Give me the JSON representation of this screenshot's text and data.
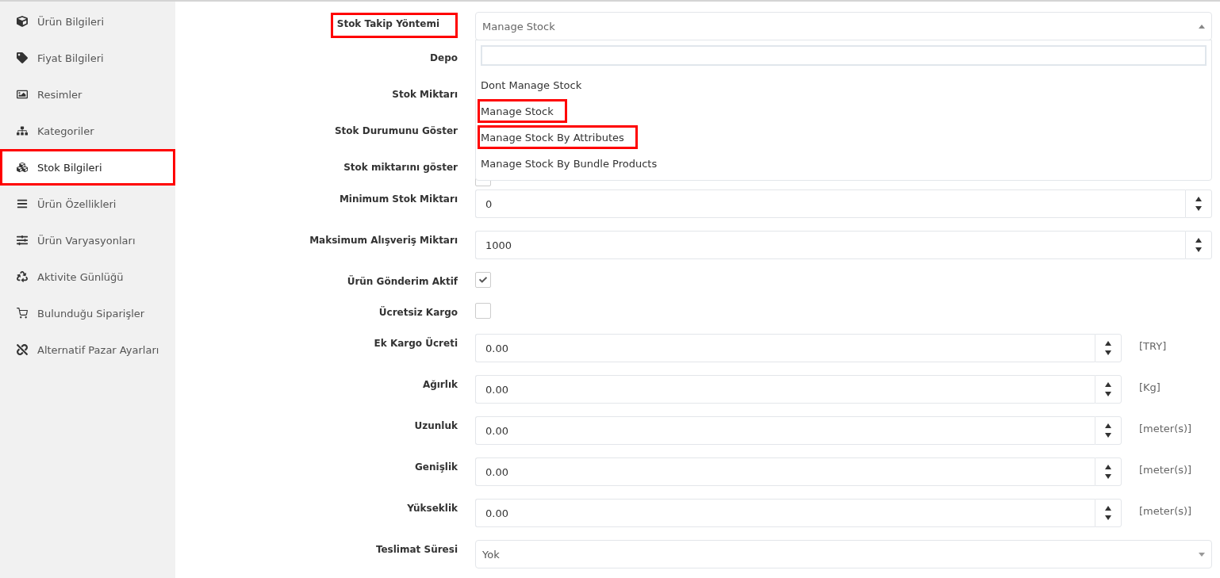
{
  "sidebar": {
    "items": [
      {
        "label": "Ürün Bilgileri",
        "selected": false,
        "highlighted": false
      },
      {
        "label": "Fiyat Bilgileri",
        "selected": false,
        "highlighted": false
      },
      {
        "label": "Resimler",
        "selected": false,
        "highlighted": false
      },
      {
        "label": "Kategoriler",
        "selected": false,
        "highlighted": false
      },
      {
        "label": "Stok Bilgileri",
        "selected": true,
        "highlighted": true
      },
      {
        "label": "Ürün Özellikleri",
        "selected": false,
        "highlighted": false
      },
      {
        "label": "Ürün Varyasyonları",
        "selected": false,
        "highlighted": false
      },
      {
        "label": "Aktivite Günlüğü",
        "selected": false,
        "highlighted": false
      },
      {
        "label": "Bulunduğu Siparişler",
        "selected": false,
        "highlighted": false
      },
      {
        "label": "Alternatif Pazar Ayarları",
        "selected": false,
        "highlighted": false
      }
    ]
  },
  "form": {
    "rows": [
      {
        "kind": "select",
        "label": "Stok Takip Yöntemi",
        "highlighted": true,
        "value": "Manage Stock",
        "expanded": true,
        "options": [
          {
            "label": "Dont Manage Stock",
            "highlighted": false
          },
          {
            "label": "Manage Stock",
            "highlighted": true
          },
          {
            "label": "Manage Stock By Attributes",
            "highlighted": true
          },
          {
            "label": "Manage Stock By Bundle Products",
            "highlighted": false
          }
        ]
      },
      {
        "kind": "hidden",
        "label": "Depo",
        "highlighted": false
      },
      {
        "kind": "hidden",
        "label": "Stok Miktarı",
        "highlighted": false
      },
      {
        "kind": "hidden",
        "label": "Stok Durumunu Göster",
        "highlighted": false
      },
      {
        "kind": "covered-checkbox",
        "label": "Stok miktarını göster",
        "highlighted": false,
        "checked": false
      },
      {
        "kind": "number",
        "label": "Minimum Stok Miktarı",
        "highlighted": false,
        "value": "0"
      },
      {
        "kind": "number",
        "label": "Maksimum Alışveriş Miktarı",
        "highlighted": false,
        "value": "1000"
      },
      {
        "kind": "checkbox",
        "label": "Ürün Gönderim Aktif",
        "highlighted": false,
        "checked": true
      },
      {
        "kind": "checkbox",
        "label": "Ücretsiz Kargo",
        "highlighted": false,
        "checked": false
      },
      {
        "kind": "number",
        "label": "Ek Kargo Ücreti",
        "highlighted": false,
        "value": "0.00",
        "unit": "[TRY]"
      },
      {
        "kind": "number",
        "label": "Ağırlık",
        "highlighted": false,
        "value": "0.00",
        "unit": "[Kg]"
      },
      {
        "kind": "number",
        "label": "Uzunluk",
        "highlighted": false,
        "value": "0.00",
        "unit": "[meter(s)]"
      },
      {
        "kind": "number",
        "label": "Genişlik",
        "highlighted": false,
        "value": "0.00",
        "unit": "[meter(s)]"
      },
      {
        "kind": "number",
        "label": "Yükseklik",
        "highlighted": false,
        "value": "0.00",
        "unit": "[meter(s)]"
      },
      {
        "kind": "select",
        "label": "Teslimat Süresi",
        "highlighted": false,
        "value": "Yok",
        "expanded": false
      }
    ]
  }
}
